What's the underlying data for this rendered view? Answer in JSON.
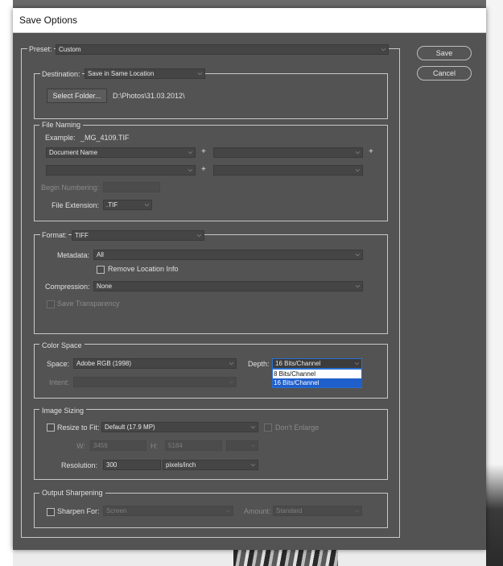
{
  "dialog": {
    "title": "Save Options",
    "preset_label": "Preset:",
    "preset_value": "Custom",
    "save_label": "Save",
    "cancel_label": "Cancel"
  },
  "destination": {
    "label": "Destination:",
    "value": "Save in Same Location",
    "select_folder_label": "Select Folder...",
    "path": "D:\\Photos\\31.03.2012\\"
  },
  "file_naming": {
    "title": "File Naming",
    "example_label": "Example:",
    "example_value": "_MG_4109.TIF",
    "field1": "Document Name",
    "field2": "",
    "field3": "",
    "field4": "",
    "plus": "+",
    "begin_numbering_label": "Begin Numbering:",
    "begin_numbering_value": "",
    "extension_label": "File Extension:",
    "extension_value": ".TIF"
  },
  "format": {
    "label": "Format:",
    "value": "TIFF",
    "metadata_label": "Metadata:",
    "metadata_value": "All",
    "remove_location_label": "Remove Location Info",
    "compression_label": "Compression:",
    "compression_value": "None",
    "save_transparency_label": "Save Transparency"
  },
  "color_space": {
    "title": "Color Space",
    "space_label": "Space:",
    "space_value": "Adobe RGB (1998)",
    "depth_label": "Depth:",
    "depth_value": "16 Bits/Channel",
    "depth_options": [
      "8 Bits/Channel",
      "16 Bits/Channel"
    ],
    "intent_label": "Intent:",
    "intent_value": ""
  },
  "image_sizing": {
    "title": "Image Sizing",
    "resize_label": "Resize to Fit:",
    "resize_value": "Default  (17.9 MP)",
    "dont_enlarge_label": "Don't Enlarge",
    "w_label": "W:",
    "w_value": "3456",
    "h_label": "H:",
    "h_value": "5184",
    "unit_value": "",
    "resolution_label": "Resolution:",
    "resolution_value": "300",
    "resolution_unit": "pixels/inch"
  },
  "output_sharpening": {
    "title": "Output Sharpening",
    "sharpen_label": "Sharpen For:",
    "sharpen_value": "Screen",
    "amount_label": "Amount:",
    "amount_value": "Standard"
  }
}
